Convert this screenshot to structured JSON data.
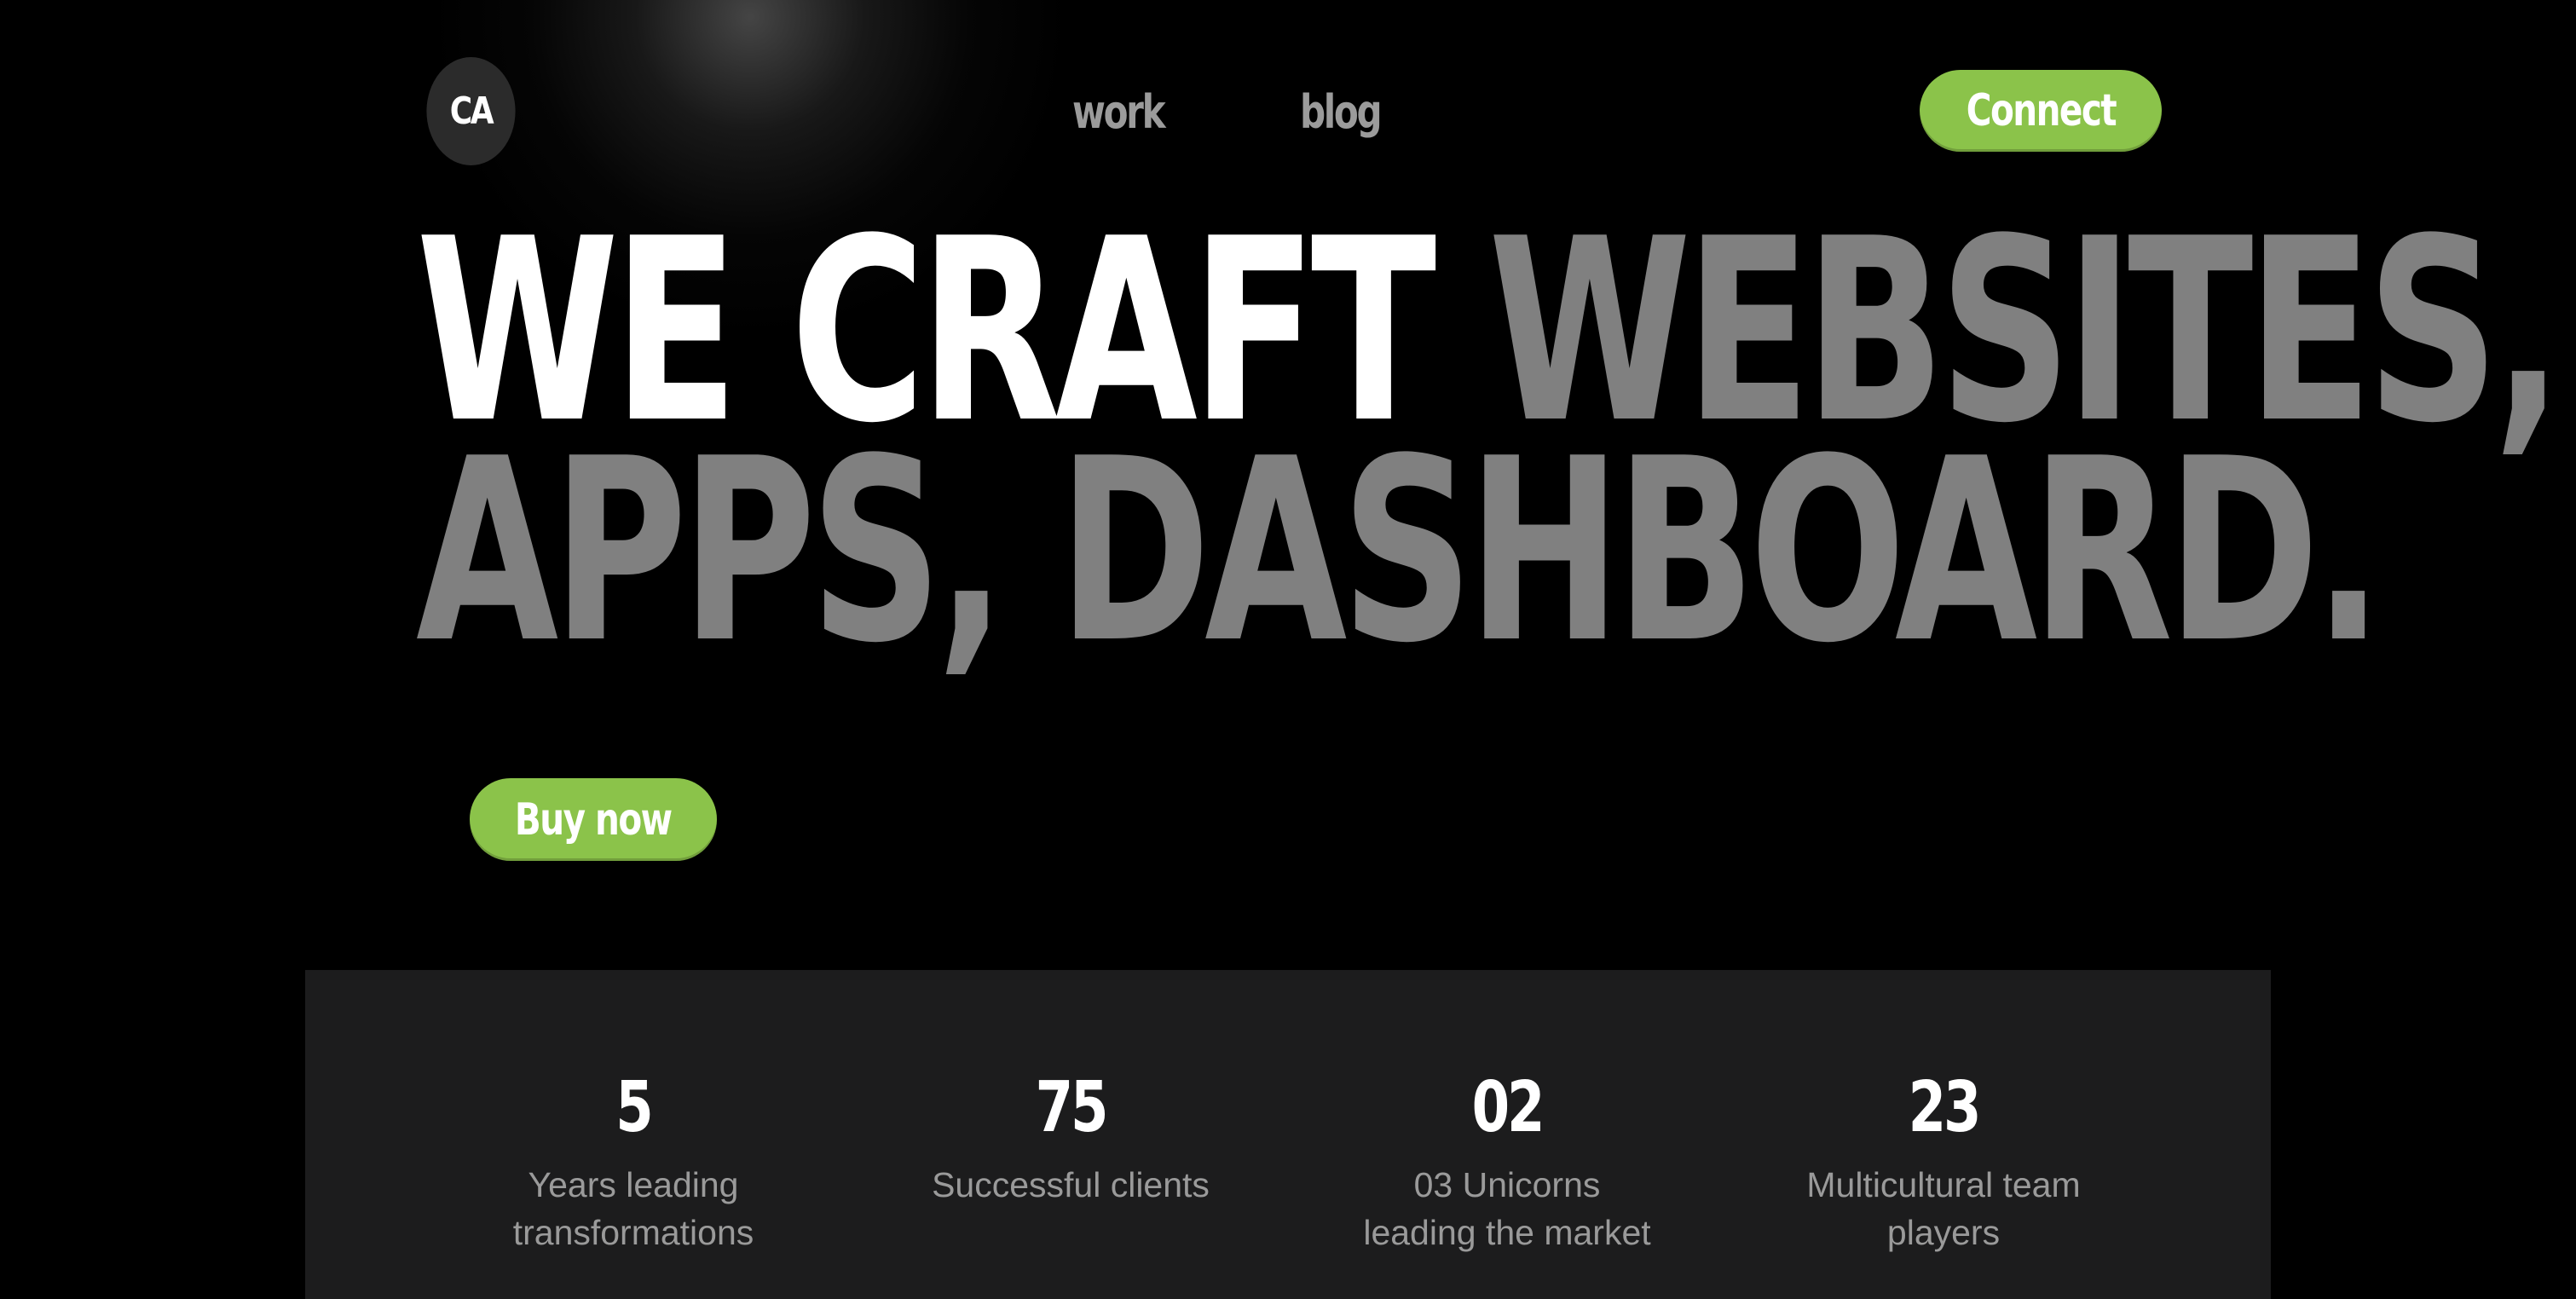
{
  "header": {
    "logo_text": "CA",
    "nav": [
      {
        "label": "work"
      },
      {
        "label": "blog"
      }
    ],
    "connect_label": "Connect"
  },
  "hero": {
    "headline_white": "WE CRAFT",
    "headline_gray_line1": "WEBSITES,",
    "headline_gray_line2": "APPS, DASHBOARD.",
    "cta_label": "Buy now"
  },
  "stats": [
    {
      "number": "5",
      "label": "Years leading\ntransformations"
    },
    {
      "number": "75",
      "label": "Successful clients"
    },
    {
      "number": "02",
      "label": "03 Unicorns\nleading the market"
    },
    {
      "number": "23",
      "label": "Multicultural team\nplayers"
    }
  ],
  "colors": {
    "background": "#000000",
    "accent": "#8bc34a",
    "headline_gray": "#808080",
    "stats_band": "#1c1c1d"
  }
}
